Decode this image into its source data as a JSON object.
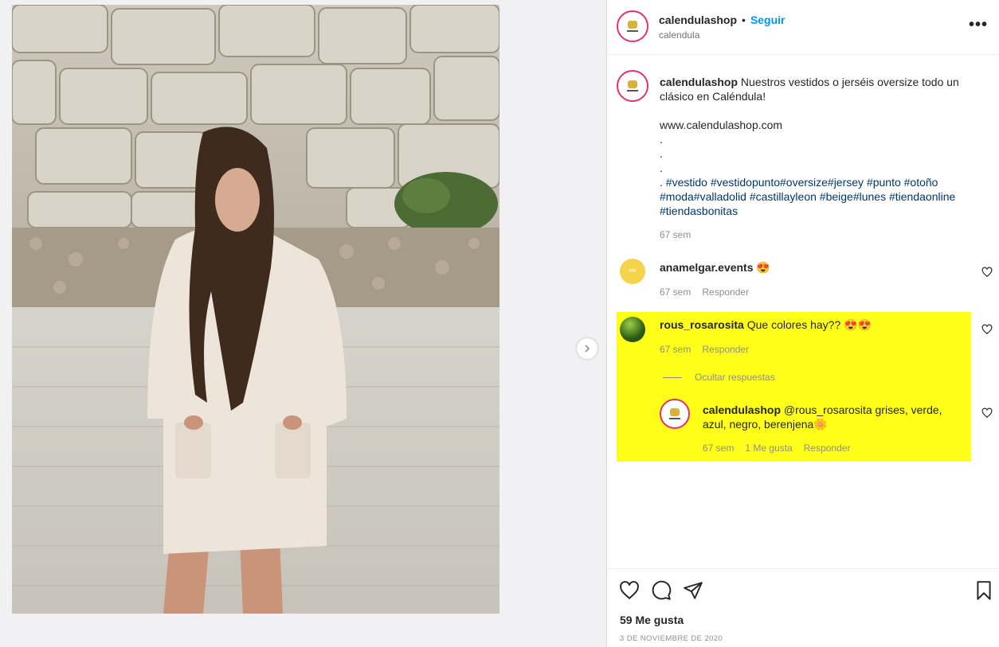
{
  "post": {
    "username": "calendulashop",
    "follow_label": "Seguir",
    "location": "calendula",
    "more_label": "•••"
  },
  "caption": {
    "username": "calendulashop",
    "text": "Nuestros vestidos o jerséis oversize todo un clásico en Caléndula!",
    "link": "www.calendulashop.com",
    "dots": [
      ".",
      ".",
      "."
    ],
    "hashtag_prefix": ". ",
    "hashtags_line1": "#vestido #vestidopunto#oversize#jersey #punto #otoño",
    "hashtags_line2": "#moda#valladolid #castillayleon #beige#lunes #tiendaonline",
    "hashtags_line3": "#tiendasbonitas",
    "time": "67 sem"
  },
  "comments": [
    {
      "username": "anamelgar.events",
      "text": "😍",
      "time": "67 sem",
      "reply_label": "Responder",
      "avatar_text": "AM"
    },
    {
      "username": "rous_rosarosita",
      "text": "Que colores hay?? 😍😍",
      "time": "67 sem",
      "reply_label": "Responder",
      "hide_replies_label": "Ocultar respuestas",
      "replies": [
        {
          "username": "calendulashop",
          "text": "@rous_rosarosita grises, verde, azul, negro, berenjena🌼",
          "time": "67 sem",
          "likes_label": "1 Me gusta",
          "reply_label": "Responder"
        }
      ]
    }
  ],
  "footer": {
    "likes": "59 Me gusta",
    "date": "3 DE NOVIEMBRE DE 2020"
  },
  "icons": {
    "next": "chevron-right-icon",
    "like": "heart-icon",
    "comment": "speech-bubble-icon",
    "share": "paper-plane-icon",
    "save": "bookmark-icon"
  },
  "colors": {
    "accent": "#0095f6",
    "highlight": "#ffff1a",
    "hashtag": "#00376b"
  }
}
